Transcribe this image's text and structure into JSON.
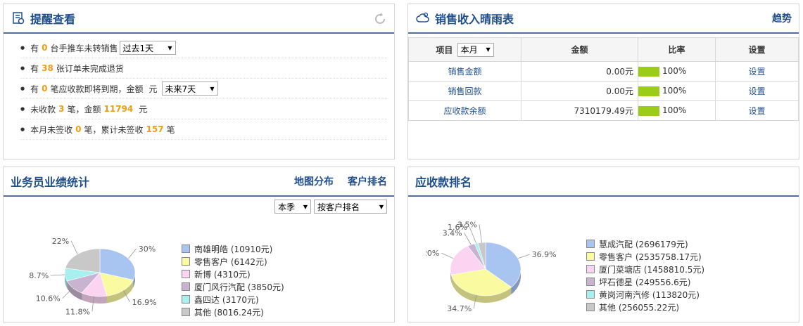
{
  "reminder": {
    "title": "提醒查看",
    "items": [
      {
        "pre": "有",
        "num": "0",
        "post": "台手推车未转销售",
        "select": "过去1天"
      },
      {
        "pre": "有",
        "num": "38",
        "post": "张订单未完成退货"
      },
      {
        "pre": "有",
        "num": "0",
        "post": "笔应收款即将到期，金额",
        "post2": "元",
        "select": "未来7天"
      },
      {
        "pre": "未收款",
        "num": "3",
        "mid": "笔，金额",
        "num2": "11794",
        "post": "元"
      },
      {
        "pre": "本月未签收",
        "num": "0",
        "mid": "笔，累计未签收",
        "num2": "157",
        "post": "笔"
      }
    ]
  },
  "sales": {
    "title": "销售收入晴雨表",
    "trend_link": "趋势",
    "headers": {
      "item": "项目",
      "period": "本月",
      "amount": "金额",
      "ratio": "比率",
      "setting": "设置"
    },
    "rows": [
      {
        "name": "销售金额",
        "amount": "0.00元",
        "ratio": "100%",
        "setting": "设置"
      },
      {
        "name": "销售回款",
        "amount": "0.00元",
        "ratio": "100%",
        "setting": "设置"
      },
      {
        "name": "应收款余额",
        "amount": "7310179.49元",
        "ratio": "100%",
        "setting": "设置"
      }
    ]
  },
  "perf": {
    "title": "业务员业绩统计",
    "links": [
      "地图分布",
      "客户排名"
    ],
    "select1": "本季",
    "select2": "按客户排名"
  },
  "recv": {
    "title": "应收款排名"
  },
  "chart_data": [
    {
      "type": "pie",
      "categories": [
        "南雄明皓 (10910元)",
        "零售客户 (6142元)",
        "新博 (4310元)",
        "厦门风行汽配 (3850元)",
        "鑫四达 (3170元)",
        "其他 (8016.24元)"
      ],
      "values": [
        10910,
        6142,
        4310,
        3850,
        3170,
        8016.24
      ],
      "pct_labels": [
        "30%",
        "16.9%",
        "11.8%",
        "10.6%",
        "8.7%",
        "22%"
      ],
      "colors": [
        "#a8c4f0",
        "#fafaa0",
        "#fad4f0",
        "#c8b4d0",
        "#a8f0f0",
        "#c8c8c8"
      ]
    },
    {
      "type": "pie",
      "categories": [
        "慧成汽配 (2696179元)",
        "零售客户 (2535758.17元)",
        "厦门菜塘店 (1458810.5元)",
        "坪石德星 (249556.6元)",
        "黄岗河南汽修 (113820元)",
        "其他 (256055.22元)"
      ],
      "values": [
        2696179,
        2535758.17,
        1458810.5,
        249556.6,
        113820,
        256055.22
      ],
      "pct_labels": [
        "36.9%",
        "34.7%",
        "20%",
        "3.4%",
        "1.6%",
        "3.5%"
      ],
      "colors": [
        "#a8c4f0",
        "#fafaa0",
        "#fad4f0",
        "#c8b4d0",
        "#a8f0f0",
        "#c8c8c8"
      ]
    }
  ]
}
